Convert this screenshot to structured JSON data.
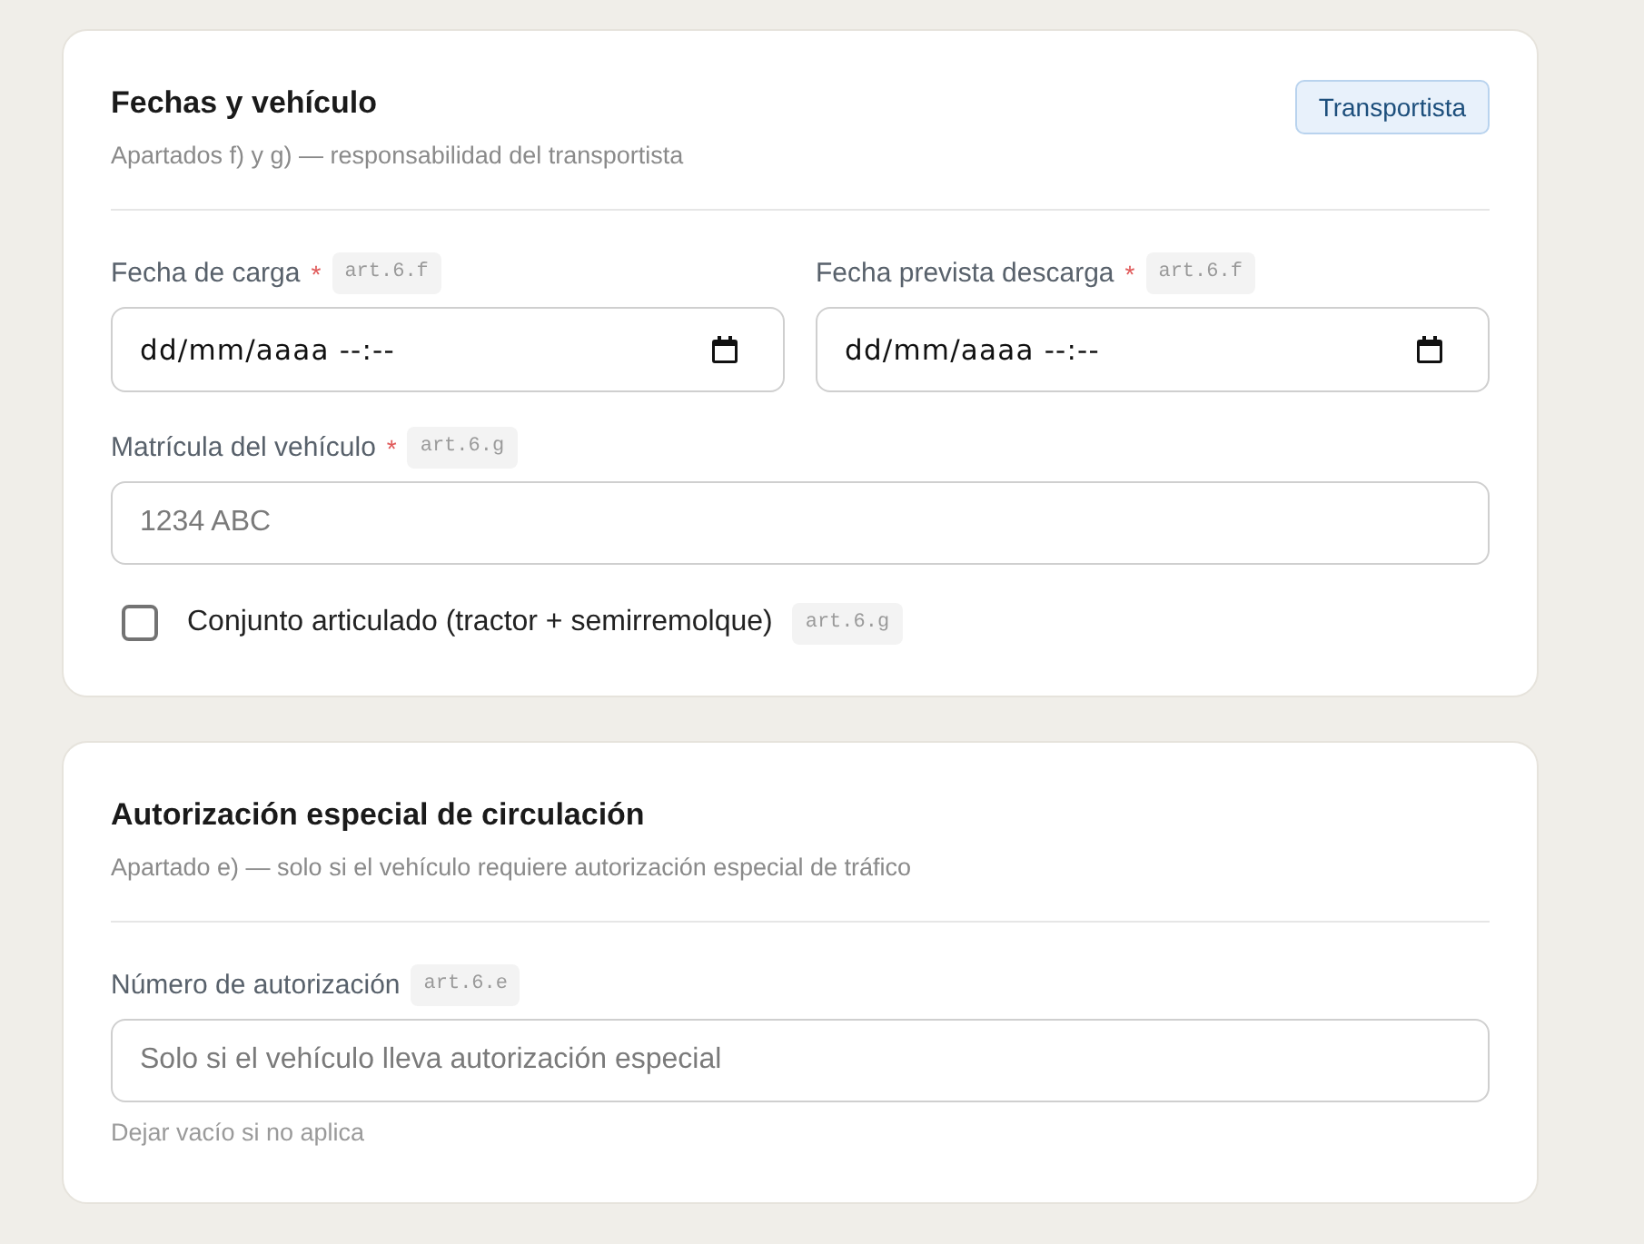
{
  "sections": [
    {
      "title": "Fechas y vehículo",
      "subtitle": "Apartados f) y g) — responsabilidad del transportista",
      "badge": "Transportista",
      "rows": [
        {
          "fields": [
            {
              "kind": "date",
              "label": "Fecha de carga",
              "required_mark": "*",
              "ref": "art.6.f",
              "format": "dd/mm/aaaa --:--"
            },
            {
              "kind": "date",
              "label": "Fecha prevista descarga",
              "required_mark": "*",
              "ref": "art.6.f",
              "format": "dd/mm/aaaa --:--"
            }
          ]
        },
        {
          "fields": [
            {
              "kind": "text",
              "label": "Matrícula del vehículo",
              "required_mark": "*",
              "ref": "art.6.g",
              "placeholder": "1234 ABC"
            }
          ]
        },
        {
          "fields": [
            {
              "kind": "checkbox",
              "label": "Conjunto articulado (tractor + semirremolque)",
              "checked": false,
              "ref": "art.6.g"
            }
          ]
        }
      ]
    },
    {
      "title": "Autorización especial de circulación",
      "subtitle": "Apartado e) — solo si el vehículo requiere autorización especial de tráfico",
      "rows": [
        {
          "fields": [
            {
              "kind": "text",
              "label": "Número de autorización",
              "ref": "art.6.e",
              "placeholder": "Solo si el vehículo lleva autorización especial",
              "hint": "Dejar vacío si no aplica"
            }
          ]
        }
      ]
    }
  ]
}
